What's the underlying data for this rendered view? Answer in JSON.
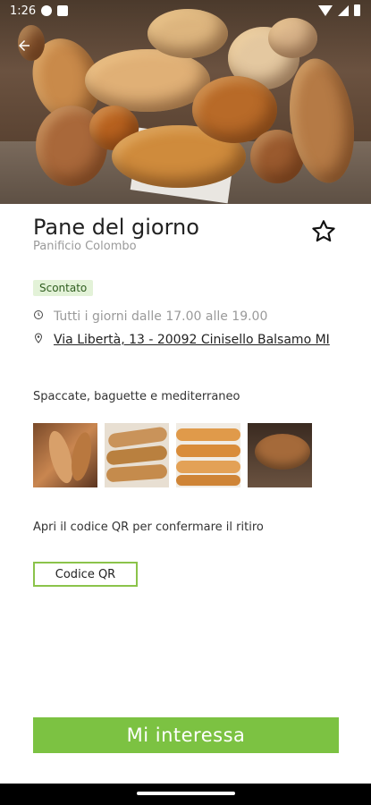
{
  "status_bar": {
    "time": "1:26"
  },
  "product": {
    "title": "Pane del giorno",
    "shop": "Panificio Colombo",
    "badge": "Scontato",
    "hours": "Tutti i giorni dalle 17.00 alle 19.00",
    "address": "Via Libertà, 13 - 20092 Cinisello Balsamo MI",
    "description": "Spaccate, baguette e mediterraneo"
  },
  "pickup": {
    "hint": "Apri il codice QR per confermare il ritiro",
    "qr_button_label": "Codice QR"
  },
  "cta_label": "Mi interessa",
  "colors": {
    "accent": "#7cc242",
    "badge_bg": "#e3f2d8"
  },
  "icons": {
    "back": "arrow-back-icon",
    "favorite": "star-outline-icon",
    "clock": "clock-icon",
    "location": "location-pin-icon"
  }
}
